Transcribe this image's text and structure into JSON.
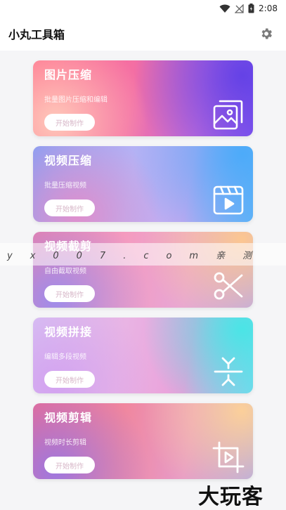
{
  "status_bar": {
    "time": "2:08"
  },
  "app_bar": {
    "title": "小丸工具箱"
  },
  "cards": [
    {
      "title": "图片压缩",
      "subtitle": "批量图片压缩和编辑",
      "button": "开始制作",
      "icon": "image-icon"
    },
    {
      "title": "视频压缩",
      "subtitle": "批量压缩视频",
      "button": "开始制作",
      "icon": "video-icon"
    },
    {
      "title": "视频截剪",
      "subtitle": "自由截取视频",
      "button": "开始制作",
      "icon": "scissors-icon"
    },
    {
      "title": "视频拼接",
      "subtitle": "编辑多段视频",
      "button": "开始制作",
      "icon": "merge-icon"
    },
    {
      "title": "视频剪辑",
      "subtitle": "视频时长剪辑",
      "button": "开始制作",
      "icon": "crop-play-icon"
    }
  ],
  "watermark": {
    "text": "yx007.com亲测"
  },
  "brand": {
    "text": "大玩客"
  }
}
